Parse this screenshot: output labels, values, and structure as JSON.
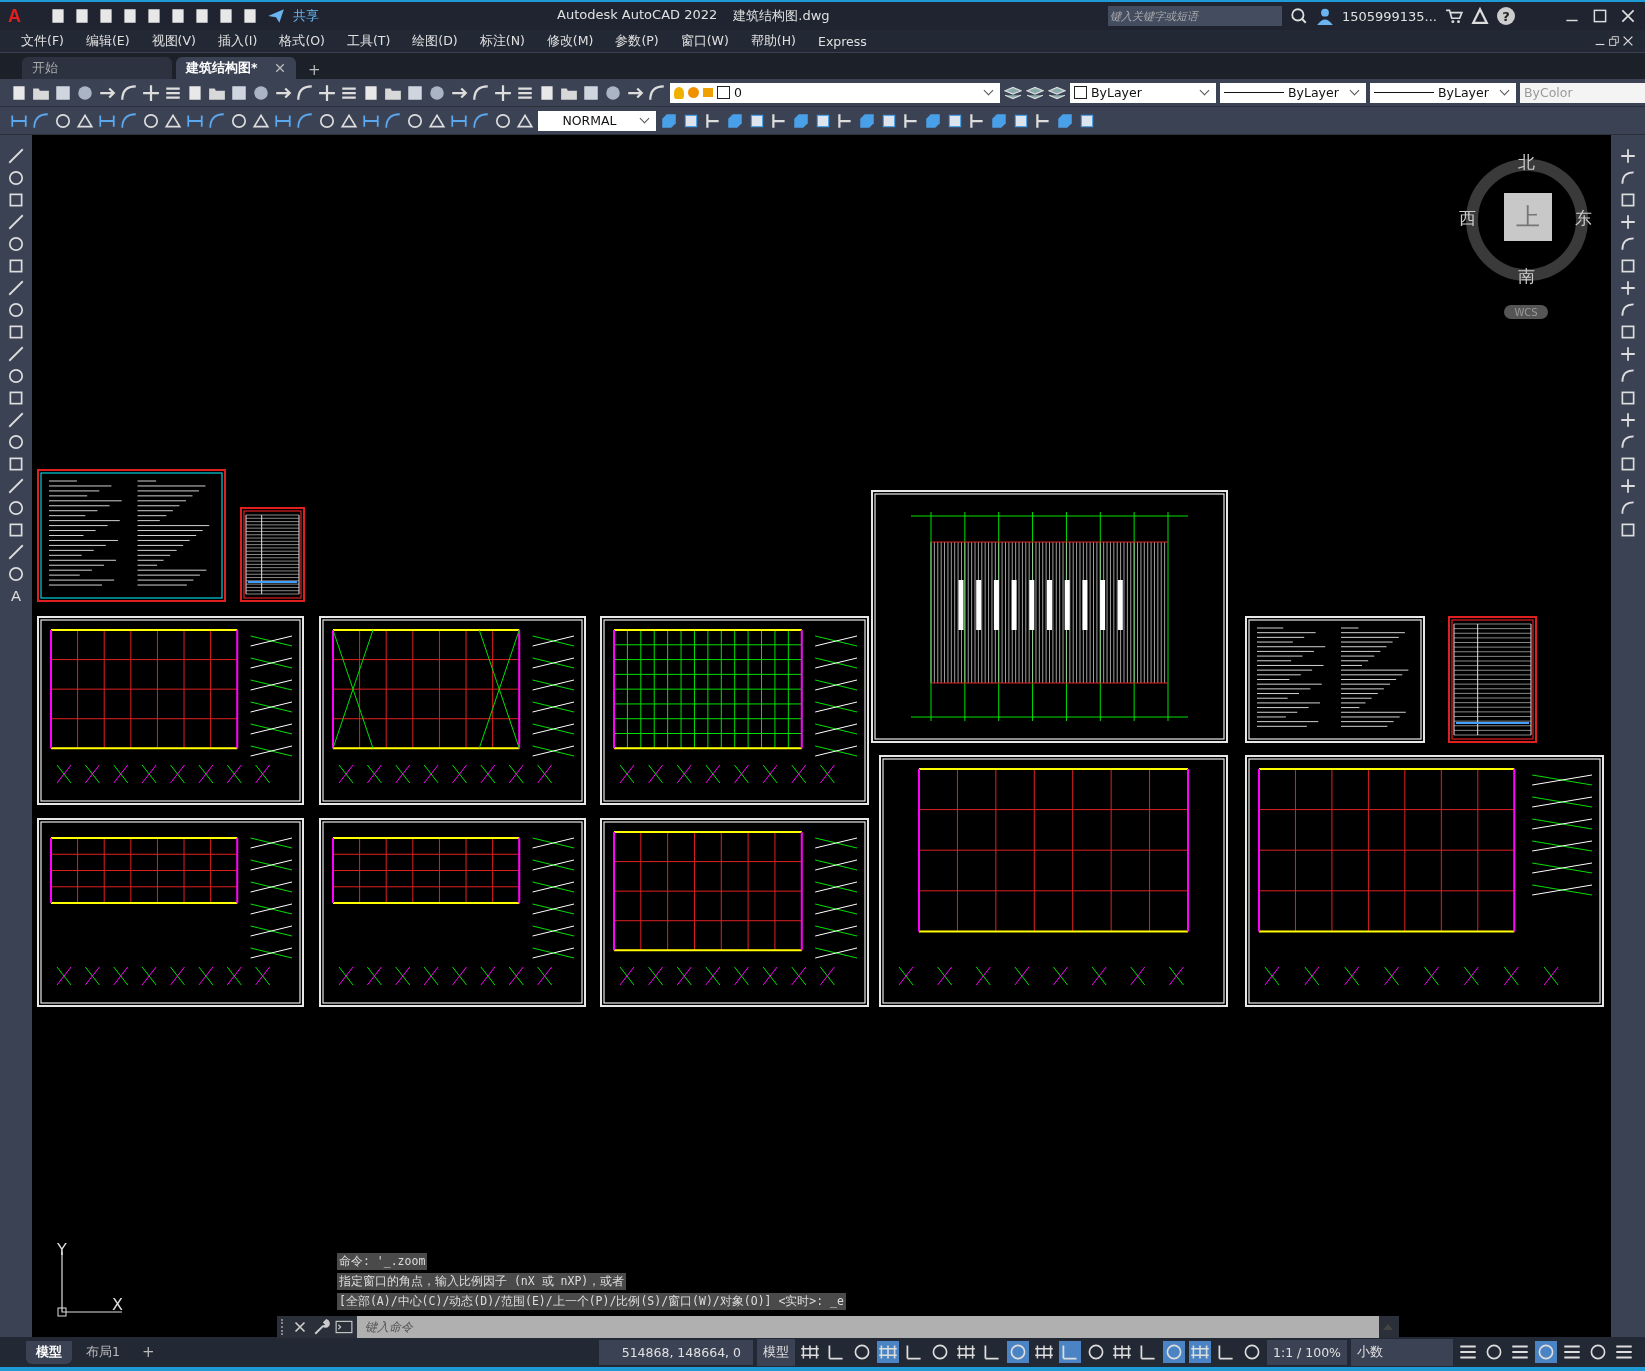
{
  "title_bar": {
    "logo": "A",
    "share": "共享",
    "app_title": "Autodesk AutoCAD 2022",
    "file_name": "建筑结构图.dwg",
    "search": {
      "placeholder": "键入关键字或短语"
    },
    "user": "1505999135...",
    "help": "?"
  },
  "menu": [
    "文件(F)",
    "编辑(E)",
    "视图(V)",
    "插入(I)",
    "格式(O)",
    "工具(T)",
    "绘图(D)",
    "标注(N)",
    "修改(M)",
    "参数(P)",
    "窗口(W)",
    "帮助(H)",
    "Express"
  ],
  "doc_tabs": [
    {
      "label": "开始",
      "selected": false
    },
    {
      "label": "建筑结构图*",
      "selected": true
    }
  ],
  "new_tab": "+",
  "layer": {
    "value": "0"
  },
  "properties": [
    {
      "value": "ByLayer",
      "kind": "color",
      "disabled": false
    },
    {
      "value": "ByLayer",
      "kind": "line",
      "disabled": false
    },
    {
      "value": "ByLayer",
      "kind": "line",
      "disabled": false
    },
    {
      "value": "ByColor",
      "kind": "plain",
      "disabled": true
    }
  ],
  "text_style": {
    "value": "NORMAL"
  },
  "viewcube": {
    "north": "北",
    "west": "西",
    "east": "东",
    "south": "南",
    "top": "上",
    "wcs": "WCS"
  },
  "ucs": {
    "y": "Y",
    "x": "X"
  },
  "text_tool": "A",
  "command_history": [
    "命令: '_.zoom",
    "指定窗口的角点，输入比例因子 (nX 或 nXP)，或者",
    "[全部(A)/中心(C)/动态(D)/范围(E)/上一个(P)/比例(S)/窗口(W)/对象(O)] <实时>: _e"
  ],
  "command_input": {
    "placeholder": "键入命令"
  },
  "layout_tabs": [
    {
      "label": "模型",
      "selected": true
    },
    {
      "label": "布局1",
      "selected": false
    }
  ],
  "add_layout": "+",
  "status_bar": {
    "coordinates": "514868, 148664, 0",
    "model": "模型",
    "scale": "1:1 / 100%",
    "units": "小数"
  },
  "status_toggles": [
    {
      "on": false
    },
    {
      "on": false
    },
    {
      "on": false
    },
    {
      "on": true
    },
    {
      "on": false
    },
    {
      "on": false
    },
    {
      "on": false
    },
    {
      "on": false
    },
    {
      "on": true
    },
    {
      "on": false
    },
    {
      "on": true
    },
    {
      "on": false
    },
    {
      "on": false
    },
    {
      "on": false
    },
    {
      "on": true
    },
    {
      "on": true
    },
    {
      "on": false
    },
    {
      "on": false
    }
  ],
  "status_tail": [
    {
      "on": false
    },
    {
      "on": false
    },
    {
      "on": false
    },
    {
      "on": true
    },
    {
      "on": false
    },
    {
      "on": false
    },
    {
      "on": false
    }
  ]
}
